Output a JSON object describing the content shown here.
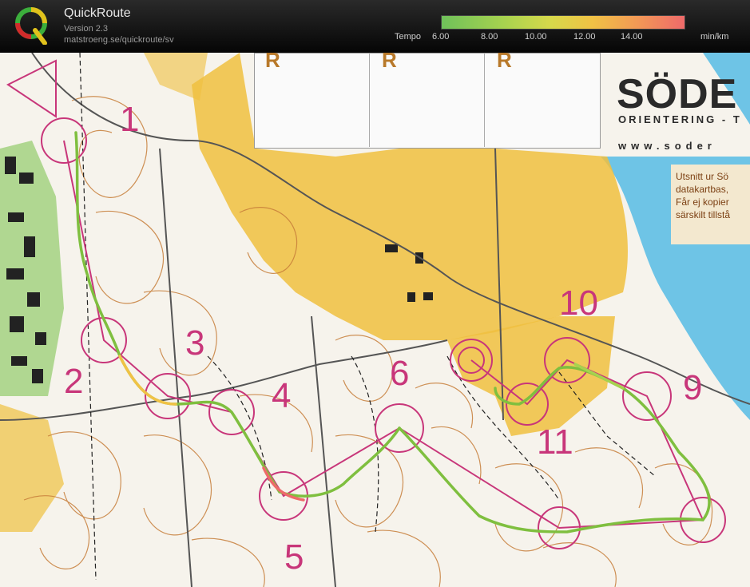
{
  "app": {
    "title": "QuickRoute",
    "version": "Version 2.3",
    "url": "matstroeng.se/quickroute/sv"
  },
  "pace_scale": {
    "label": "Tempo",
    "ticks": [
      "6.00",
      "8.00",
      "10.00",
      "12.00",
      "14.00"
    ],
    "unit": "min/km",
    "colors": [
      "#6fc05a",
      "#a6d24f",
      "#d7d84b",
      "#f0c245",
      "#f29a55",
      "#ee6a6a"
    ]
  },
  "map": {
    "legend_letters": [
      "R",
      "R",
      "R"
    ],
    "sponsor": {
      "name": "SÖDE",
      "subtitle": "ORIENTERING - T",
      "web": "www.soder"
    },
    "copyright_note": [
      "Utsnitt ur Sö",
      "datakartbas,",
      "Får ej kopier",
      "särskilt tillstå"
    ],
    "controls": [
      "1",
      "2",
      "3",
      "4",
      "5",
      "6",
      "9",
      "10",
      "11"
    ],
    "colors": {
      "course": "#c8367a",
      "open_land": "#f0c040",
      "water": "#6ec4e6",
      "contours": "#c77e3a",
      "route": "#7fbf3f"
    }
  }
}
